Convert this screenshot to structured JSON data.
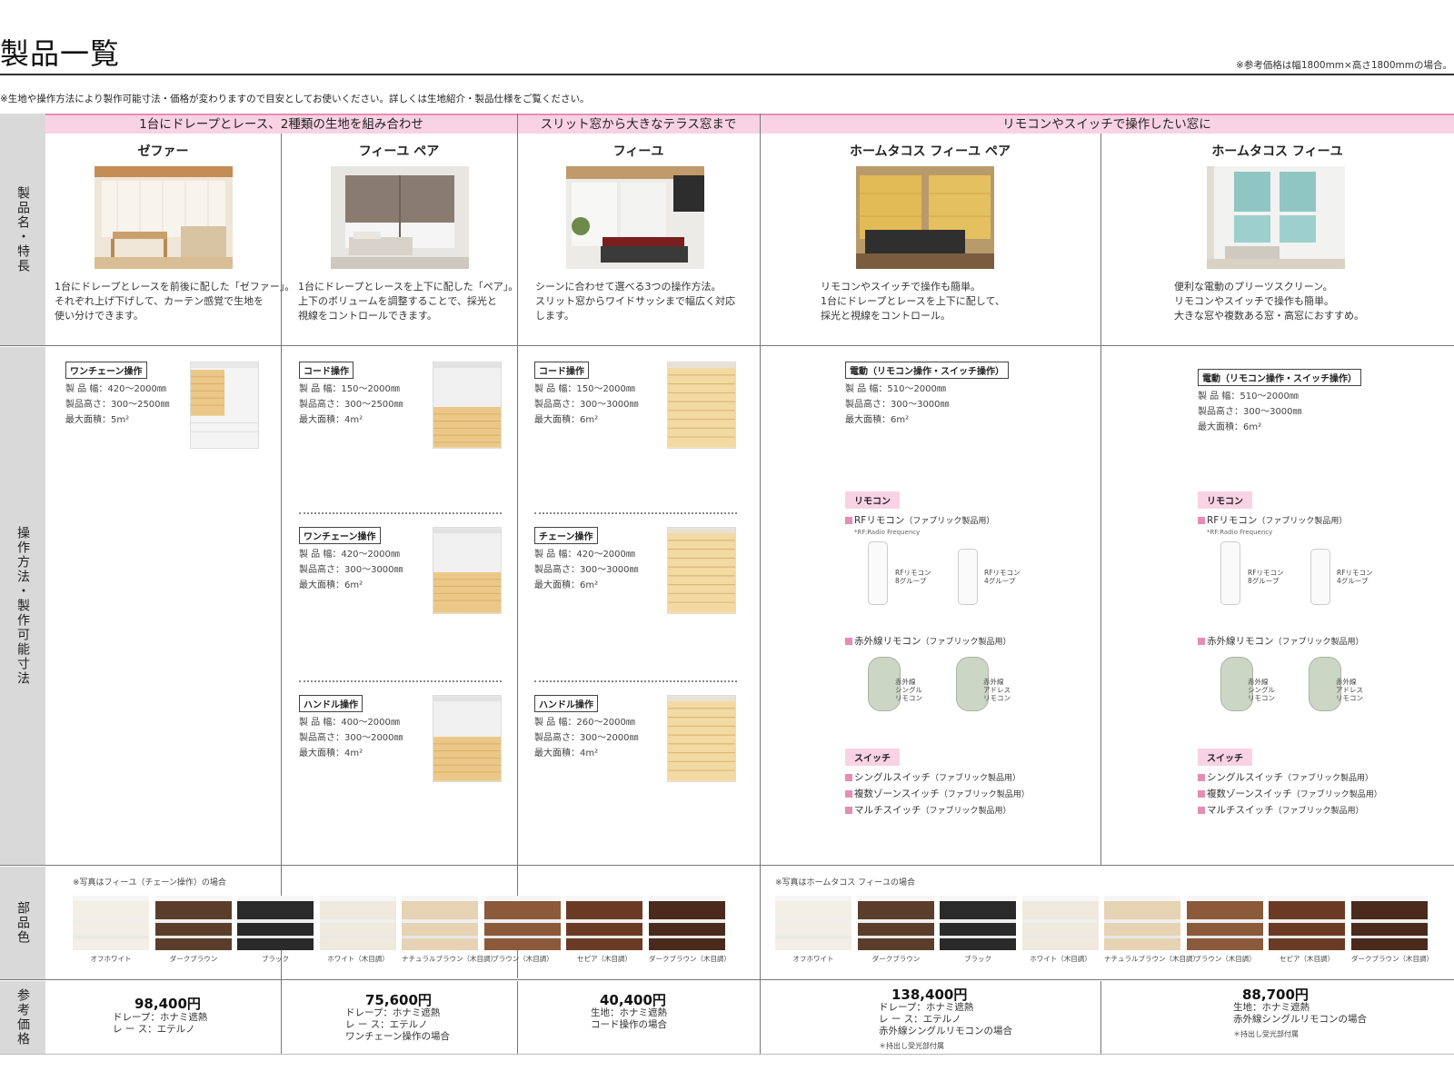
{
  "header": {
    "title": "製品一覧",
    "price_note": "※参考価格は幅1800mm×高さ1800mmの場合。",
    "main_note": "※生地や操作方法により製作可能寸法・価格が変わりますので目安としてお使いください。詳しくは生地紹介・製品仕様をご覧ください。"
  },
  "row_labels": {
    "product": "製品名・特長",
    "operation": "操作方法・製作可能寸法",
    "parts": "部品色",
    "price": "参考価格"
  },
  "bands": [
    "1台にドレープとレース、2種類の生地を組み合わせ",
    "スリット窓から大きなテラス窓まで",
    "リモコンやスイッチで操作したい窓に"
  ],
  "products": [
    {
      "name": "ゼファー",
      "desc": "1台にドレープとレースを前後に配した「ゼファー」。\nそれぞれ上げ下げして、カーテン感覚で生地を\n使い分けできます。",
      "ops": [
        {
          "label": "ワンチェーン操作",
          "width": "製 品 幅：420〜2000㎜",
          "height": "製品高さ：300〜2500㎜",
          "area": "最大面積：5m²"
        }
      ],
      "price": "98,400円",
      "price_detail": "ドレープ：ホナミ遮熱\nレ ー ス：エテルノ"
    },
    {
      "name": "フィーユ ペア",
      "desc": "1台にドレープとレースを上下に配した「ペア」。\n上下のボリュームを調整することで、採光と\n視線をコントロールできます。",
      "ops": [
        {
          "label": "コード操作",
          "width": "製 品 幅：150〜2000㎜",
          "height": "製品高さ：300〜2500㎜",
          "area": "最大面積：4m²"
        },
        {
          "label": "ワンチェーン操作",
          "width": "製 品 幅：420〜2000㎜",
          "height": "製品高さ：300〜3000㎜",
          "area": "最大面積：6m²"
        },
        {
          "label": "ハンドル操作",
          "width": "製 品 幅：400〜2000㎜",
          "height": "製品高さ：300〜2000㎜",
          "area": "最大面積：4m²"
        }
      ],
      "price": "75,600円",
      "price_detail": "ドレープ：ホナミ遮熱\nレ ー ス：エテルノ\nワンチェーン操作の場合"
    },
    {
      "name": "フィーユ",
      "desc": "シーンに合わせて選べる3つの操作方法。\nスリット窓からワイドサッシまで幅広く対応\nします。",
      "ops": [
        {
          "label": "コード操作",
          "width": "製 品 幅：150〜2000㎜",
          "height": "製品高さ：300〜3000㎜",
          "area": "最大面積：6m²"
        },
        {
          "label": "チェーン操作",
          "width": "製 品 幅：420〜2000㎜",
          "height": "製品高さ：300〜3000㎜",
          "area": "最大面積：6m²"
        },
        {
          "label": "ハンドル操作",
          "width": "製 品 幅：260〜2000㎜",
          "height": "製品高さ：300〜2000㎜",
          "area": "最大面積：4m²"
        }
      ],
      "price": "40,400円",
      "price_detail": "生地：ホナミ遮熱\nコード操作の場合"
    },
    {
      "name": "ホームタコス フィーユ ペア",
      "desc": "リモコンやスイッチで操作も簡単。\n1台にドレープとレースを上下に配して、\n採光と視線をコントロール。",
      "ops": [
        {
          "label": "電動（リモコン操作・スイッチ操作）",
          "width": "製 品 幅：510〜2000㎜",
          "height": "製品高さ：300〜3000㎜",
          "area": "最大面積：6m²"
        }
      ],
      "price": "138,400円",
      "price_detail": "ドレープ：ホナミ遮熱\nレ ー ス：エテルノ\n赤外線シングルリモコンの場合",
      "price_asterisk": "＊持出し受光部付属"
    },
    {
      "name": "ホームタコス フィーユ",
      "desc": "便利な電動のプリーツスクリーン。\nリモコンやスイッチで操作も簡単。\n大きな窓や複数ある窓・高窓におすすめ。",
      "ops": [
        {
          "label": "電動（リモコン操作・スイッチ操作）",
          "width": "製 品 幅：510〜2000㎜",
          "height": "製品高さ：300〜3000㎜",
          "area": "最大面積：6m²"
        }
      ],
      "price": "88,700円",
      "price_detail": "生地：ホナミ遮熱\n赤外線シングルリモコンの場合",
      "price_asterisk": "＊持出し受光部付属"
    }
  ],
  "remote_section": {
    "remote_tag": "リモコン",
    "rf_title": "RFリモコン",
    "rf_sub": "（ファブリック製品用）",
    "rf_note": "*RF:Radio Frequency",
    "rf_8": "RFリモコン\n8グループ",
    "rf_4": "RFリモコン\n4グループ",
    "ir_title": "赤外線リモコン",
    "ir_sub": "（ファブリック製品用）",
    "ir_single": "赤外線\nシングル\nリモコン",
    "ir_address": "赤外線\nアドレス\nリモコン",
    "switch_tag": "スイッチ",
    "switches": [
      {
        "name": "シングルスイッチ",
        "sub": "（ファブリック製品用）"
      },
      {
        "name": "複数ゾーンスイッチ",
        "sub": "（ファブリック製品用）"
      },
      {
        "name": "マルチスイッチ",
        "sub": "（ファブリック製品用）"
      }
    ]
  },
  "parts": {
    "left_note": "※写真はフィーユ（チェーン操作）の場合",
    "right_note": "※写真はホームタコス フィーユの場合",
    "colors": [
      "オフホワイト",
      "ダークブラウン",
      "ブラック",
      "ホワイト（木目調）",
      "ナチュラルブラウン（木目調）",
      "ブラウン（木目調）",
      "セピア（木目調）",
      "ダークブラウン（木目調）"
    ],
    "swatch_hex": [
      "#f3efe6",
      "#5a3e2b",
      "#2a2a2a",
      "#efe9de",
      "#e6d3b3",
      "#8a5a3a",
      "#6b3a25",
      "#4a2a1c"
    ]
  }
}
